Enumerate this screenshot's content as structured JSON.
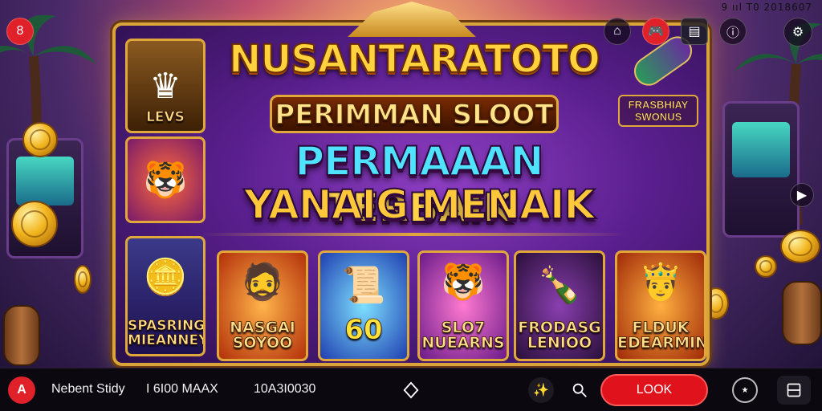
{
  "status_bar": {
    "text": "9 ııl T0 2018607"
  },
  "game": {
    "title": "NUSANTARATOTO",
    "subtitle": "PERIMMAN SLOOT",
    "headline_line1_a": "PERMAAAN ",
    "headline_line1_b": "TERBAIK",
    "headline_line2": "YANAIG MENAIK",
    "side_label": "FRASBHIAY SWONUS",
    "left_tiles": [
      {
        "label": "LEVS"
      },
      {
        "label": ""
      },
      {
        "label": "SPASRING MIEANNEY"
      }
    ],
    "cards": [
      {
        "label": "NASGAI SOYOO"
      },
      {
        "label": "60"
      },
      {
        "label": "SLO7 NUEARNS"
      },
      {
        "label": "FRODASG LENIOO"
      },
      {
        "label": "FLDUK EDEARMIN"
      }
    ]
  },
  "top_buttons": {
    "close": "8",
    "icons": [
      "home-icon",
      "gamepad-icon",
      "calendar-icon",
      "info-icon",
      "settings-icon"
    ]
  },
  "bottom_bar": {
    "logo": "A",
    "text1": "Nebent Stidy",
    "text2": "I 6I00 MAAX",
    "text3": "10A3I0030",
    "look_button": "LOOK"
  }
}
